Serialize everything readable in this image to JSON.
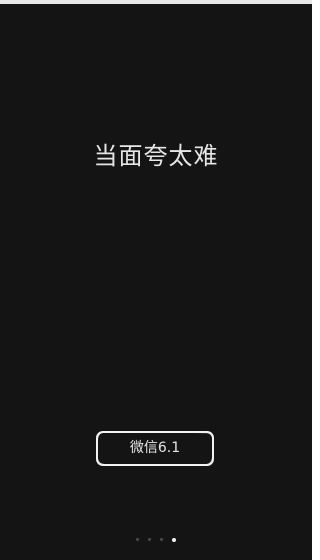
{
  "splash": {
    "headline": "当面夸太难",
    "button_label": "微信6.1"
  },
  "pager": {
    "total_pages": 4,
    "current_page": 4
  },
  "colors": {
    "background": "#141414",
    "text": "#e6e6e6",
    "dot_inactive": "#4a4a4a",
    "dot_active": "#f0f0f0"
  }
}
